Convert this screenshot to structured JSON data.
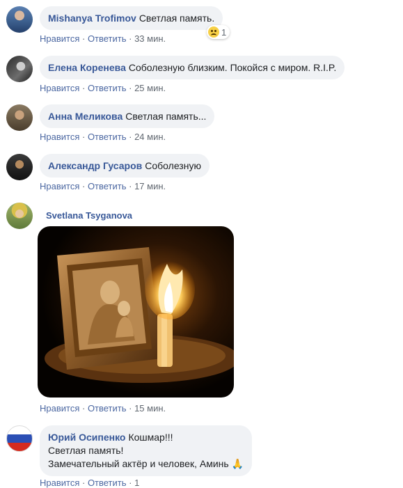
{
  "comments": [
    {
      "author": "Mishanya Trofimov",
      "text": "Светлая память.",
      "like": "Нравится",
      "reply": "Ответить",
      "time": "33 мин.",
      "reaction_count": "1"
    },
    {
      "author": "Елена Коренева",
      "text": "Соболезную близким. Покойся с миром. R.I.P.",
      "like": "Нравится",
      "reply": "Ответить",
      "time": "25 мин."
    },
    {
      "author": "Анна Меликова",
      "text": "Светлая память...",
      "like": "Нравится",
      "reply": "Ответить",
      "time": "24 мин."
    },
    {
      "author": "Александр Гусаров",
      "text": "Соболезную",
      "like": "Нравится",
      "reply": "Ответить",
      "time": "17 мин."
    },
    {
      "author": "Svetlana Tsyganova",
      "like": "Нравится",
      "reply": "Ответить",
      "time": "15 мин."
    },
    {
      "author": "Юрий Осипенко",
      "line1": "Кошмар!!!",
      "line2": "Светлая память!",
      "line3": "Замечательный актёр и человек, Аминь 🙏",
      "like": "Нравится",
      "reply": "Ответить",
      "time": "1"
    }
  ],
  "colors": {
    "bubble": "#f0f2f5",
    "author": "#385898",
    "link": "#4b67a1"
  }
}
